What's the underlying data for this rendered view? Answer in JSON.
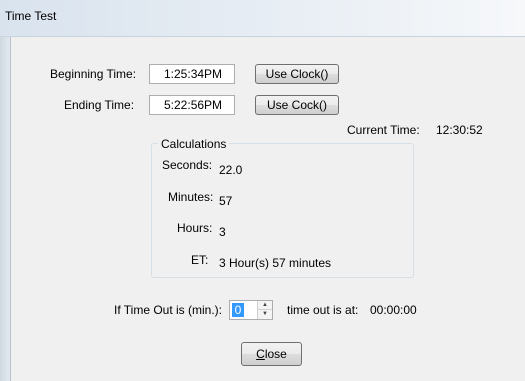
{
  "window": {
    "title": "Time Test"
  },
  "form": {
    "beginning_label": "Beginning Time:",
    "beginning_value": "1:25:34PM",
    "use_clock_label": "Use Clock()",
    "ending_label": "Ending Time:",
    "ending_value": "5:22:56PM",
    "use_cock_label": "Use Cock()",
    "current_time_label": "Current Time:",
    "current_time_value": "12:30:52"
  },
  "calculations": {
    "title": "Calculations",
    "rows": [
      {
        "label": "Seconds:",
        "value": "22.0"
      },
      {
        "label": "Minutes:",
        "value": "57"
      },
      {
        "label": "Hours:",
        "value": "3"
      },
      {
        "label": "ET:",
        "value": "3 Hour(s) 57 minutes"
      }
    ]
  },
  "timeout": {
    "label": "If Time Out is (min.):",
    "spinner_value": "0",
    "result_label": "time out is at:",
    "result_value": "00:00:00"
  },
  "close_button": {
    "label_accel": "C",
    "label_rest": "lose"
  }
}
